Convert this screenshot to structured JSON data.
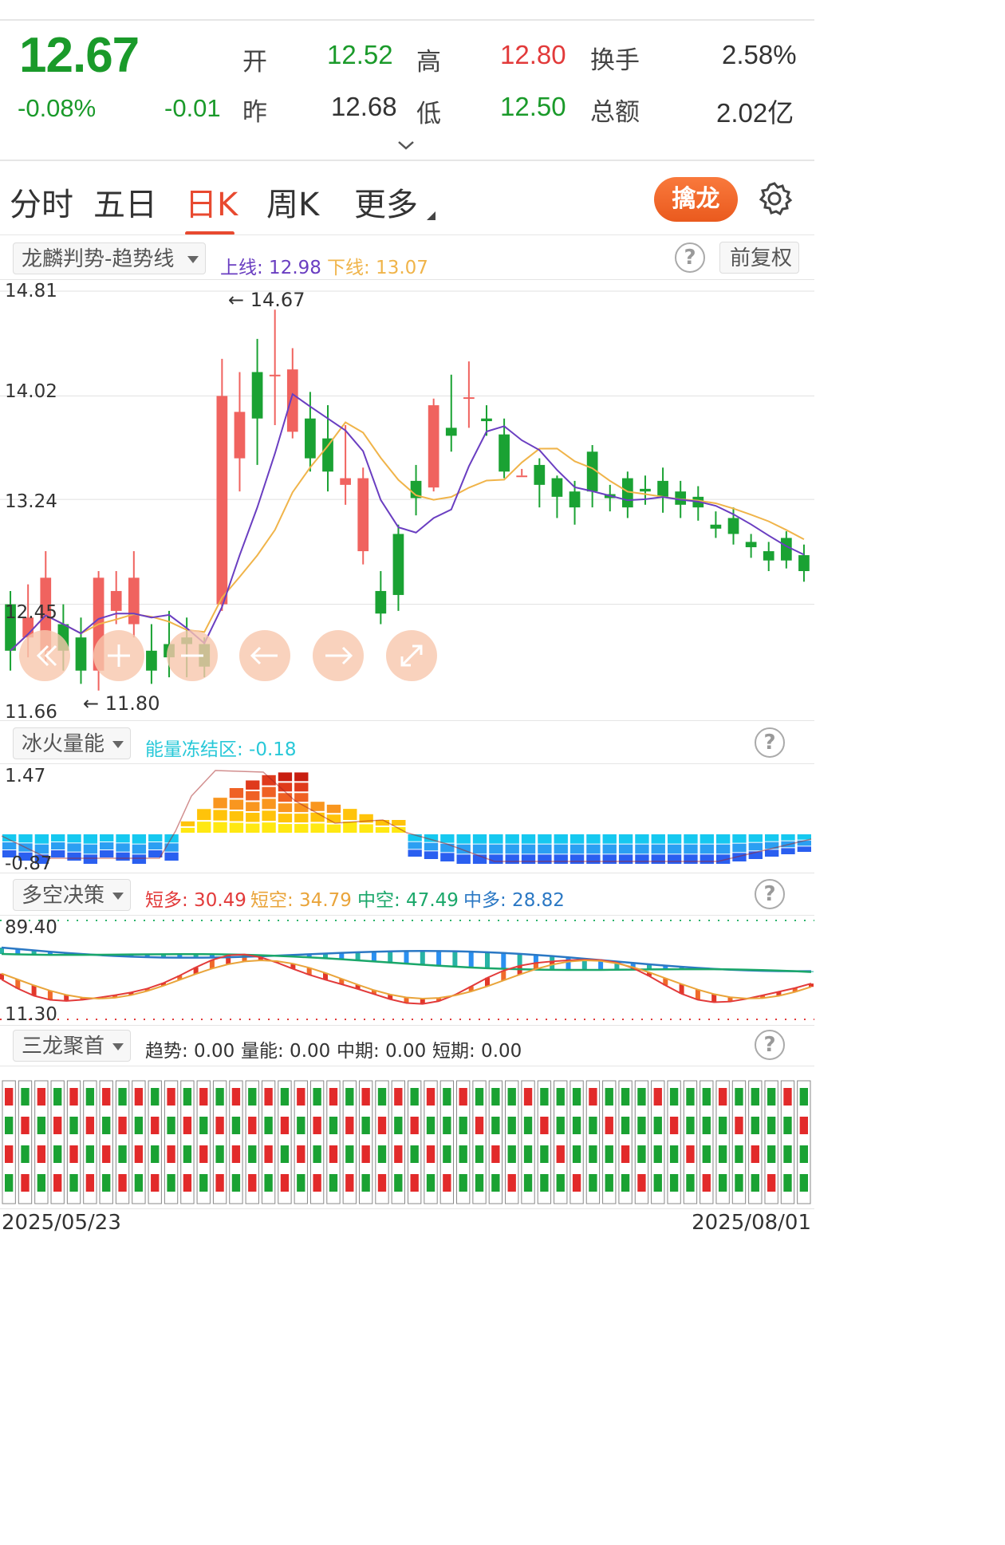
{
  "quote": {
    "price": "12.67",
    "change_pct": "-0.08%",
    "change": "-0.01",
    "open_label": "开",
    "open": "12.52",
    "high_label": "高",
    "high": "12.80",
    "turnover_label": "换手",
    "turnover": "2.58%",
    "prev_label": "昨",
    "prev_close": "12.68",
    "low_label": "低",
    "low": "12.50",
    "amount_label": "总额",
    "amount": "2.02亿"
  },
  "tabs": [
    {
      "label": "分时"
    },
    {
      "label": "五日"
    },
    {
      "label": "日K",
      "active": true
    },
    {
      "label": "周K"
    },
    {
      "label": "更多"
    }
  ],
  "qinlong_button": "擒龙",
  "main_panel": {
    "indicator": "龙麟判势-趋势线",
    "upper_label": "上线: 12.98",
    "lower_label": "下线: 13.07",
    "adjust": "前复权",
    "y_labels": [
      "14.81",
      "14.02",
      "13.24",
      "12.45",
      "11.66"
    ],
    "max_marker": "14.67",
    "min_marker": "11.80"
  },
  "volume_panel": {
    "indicator": "冰火量能",
    "freeze_label": "能量冻结区: -0.18",
    "y_top": "1.47",
    "y_bottom": "-0.87"
  },
  "decision_panel": {
    "indicator": "多空决策",
    "short_long": "短多: 30.49",
    "short_short": "短空: 34.79",
    "mid_short": "中空: 47.49",
    "mid_long": "中多: 28.82",
    "y_top": "89.40",
    "y_bottom": "11.30"
  },
  "dragon_panel": {
    "indicator": "三龙聚首",
    "trend": "趋势: 0.00",
    "energy": "量能: 0.00",
    "mid": "中期: 0.00",
    "short": "短期: 0.00"
  },
  "date_start": "2025/05/23",
  "date_end": "2025/08/01",
  "colors": {
    "up": "#f0635f",
    "down": "#1aa233",
    "ma_short": "#6a3ec1",
    "ma_long": "#f0b44a",
    "accent": "#e8492f"
  },
  "chart_data": {
    "type": "candlestick",
    "ylim": [
      11.66,
      14.81
    ],
    "candles": [
      [
        12.45,
        12.1,
        12.55,
        11.95
      ],
      [
        12.2,
        12.35,
        12.6,
        12.05
      ],
      [
        12.1,
        12.65,
        12.85,
        12.0
      ],
      [
        12.3,
        12.1,
        12.45,
        11.95
      ],
      [
        12.2,
        11.95,
        12.35,
        11.85
      ],
      [
        11.95,
        12.65,
        12.7,
        11.8
      ],
      [
        12.4,
        12.55,
        12.7,
        12.3
      ],
      [
        12.3,
        12.65,
        12.85,
        12.2
      ],
      [
        12.1,
        11.95,
        12.3,
        11.85
      ],
      [
        12.15,
        12.05,
        12.4,
        11.9
      ],
      [
        12.2,
        12.15,
        12.35,
        11.9
      ],
      [
        12.15,
        11.98,
        12.2,
        11.9
      ],
      [
        12.45,
        14.02,
        14.3,
        12.4
      ],
      [
        13.55,
        13.9,
        14.2,
        13.3
      ],
      [
        14.2,
        13.85,
        14.45,
        13.5
      ],
      [
        14.18,
        14.18,
        14.67,
        13.8
      ],
      [
        13.75,
        14.22,
        14.38,
        13.7
      ],
      [
        13.85,
        13.55,
        14.05,
        13.45
      ],
      [
        13.7,
        13.45,
        13.95,
        13.3
      ],
      [
        13.35,
        13.4,
        13.8,
        13.2
      ],
      [
        12.85,
        13.4,
        13.48,
        12.75
      ],
      [
        12.55,
        12.38,
        12.7,
        12.3
      ],
      [
        12.98,
        12.52,
        13.05,
        12.4
      ],
      [
        13.38,
        13.25,
        13.5,
        13.12
      ],
      [
        13.33,
        13.95,
        14.0,
        13.3
      ],
      [
        13.78,
        13.72,
        14.18,
        13.6
      ],
      [
        14.0,
        14.01,
        14.28,
        13.78
      ],
      [
        13.85,
        13.83,
        13.95,
        13.72
      ],
      [
        13.73,
        13.45,
        13.85,
        13.4
      ],
      [
        13.42,
        13.42,
        13.47,
        13.42
      ],
      [
        13.5,
        13.35,
        13.55,
        13.18
      ],
      [
        13.4,
        13.26,
        13.42,
        13.1
      ],
      [
        13.3,
        13.18,
        13.38,
        13.05
      ],
      [
        13.6,
        13.3,
        13.65,
        13.18
      ],
      [
        13.28,
        13.25,
        13.35,
        13.15
      ],
      [
        13.4,
        13.18,
        13.45,
        13.1
      ],
      [
        13.32,
        13.3,
        13.42,
        13.2
      ],
      [
        13.38,
        13.26,
        13.48,
        13.14
      ],
      [
        13.3,
        13.2,
        13.38,
        13.1
      ],
      [
        13.26,
        13.18,
        13.34,
        13.08
      ],
      [
        13.05,
        13.02,
        13.15,
        12.95
      ],
      [
        13.1,
        12.98,
        13.18,
        12.9
      ],
      [
        12.92,
        12.88,
        12.98,
        12.8
      ],
      [
        12.85,
        12.78,
        12.92,
        12.7
      ],
      [
        12.95,
        12.78,
        13.0,
        12.72
      ],
      [
        12.82,
        12.7,
        12.9,
        12.62
      ]
    ]
  }
}
